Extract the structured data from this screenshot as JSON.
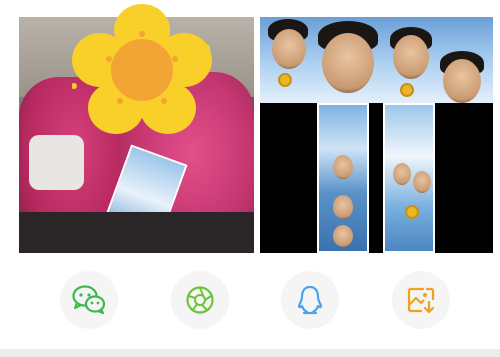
{
  "share_targets": [
    {
      "id": "wechat",
      "icon": "wechat-icon",
      "color": "#3dba4f"
    },
    {
      "id": "moments",
      "icon": "moments-icon",
      "color": "#6fc33a"
    },
    {
      "id": "qq",
      "icon": "qq-icon",
      "color": "#4aa3f0"
    },
    {
      "id": "save",
      "icon": "save-image-icon",
      "color": "#f3a01e"
    }
  ],
  "sticker": {
    "icon": "flower-sticker-icon",
    "petal_color": "#f9cf2a",
    "center_color": "#f2a434"
  }
}
